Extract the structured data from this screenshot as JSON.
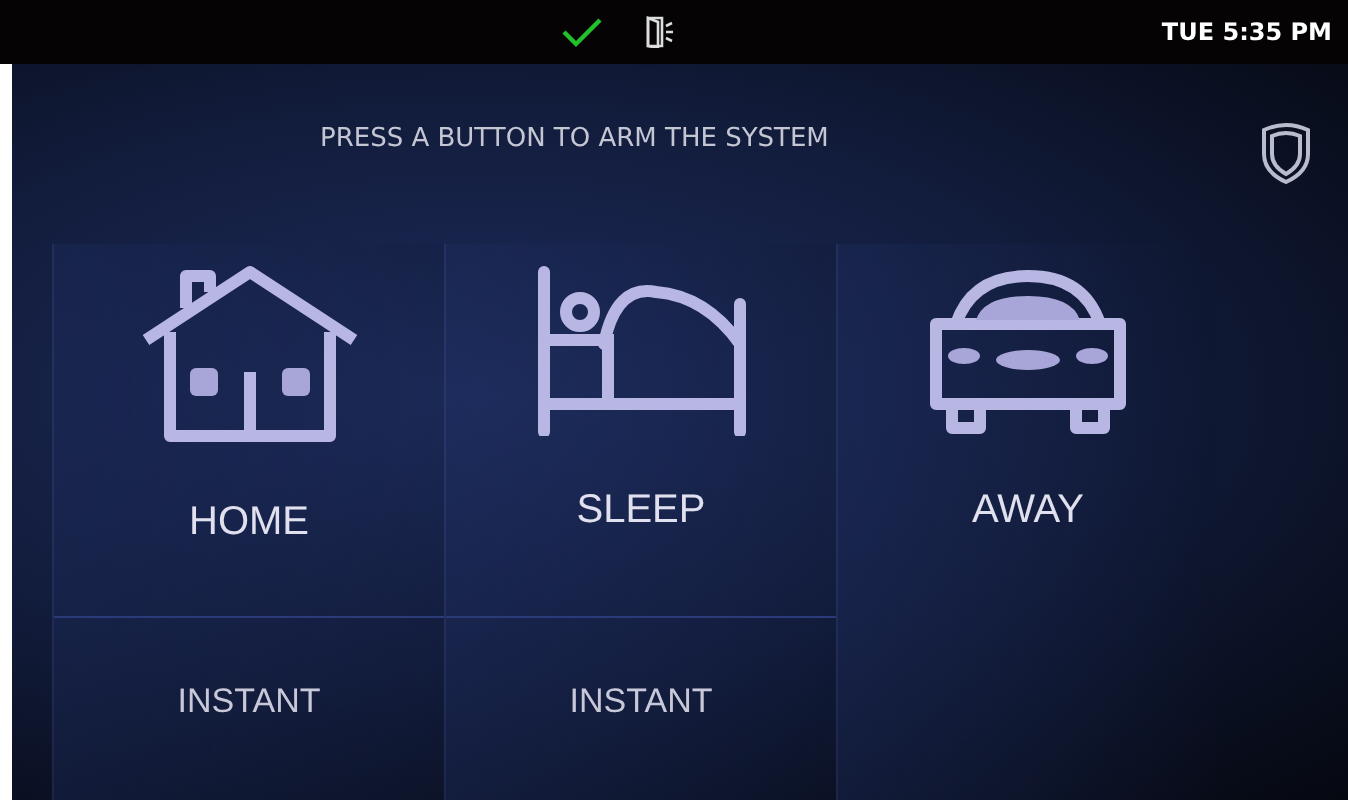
{
  "status_bar": {
    "ready": true,
    "door_open": true,
    "time": "TUE 5:35 PM"
  },
  "prompt": "PRESS A BUTTON TO ARM THE SYSTEM",
  "modes": [
    {
      "kind": "home",
      "label": "HOME",
      "instant": "INSTANT"
    },
    {
      "kind": "sleep",
      "label": "SLEEP",
      "instant": "INSTANT"
    },
    {
      "kind": "away",
      "label": "AWAY"
    }
  ]
}
